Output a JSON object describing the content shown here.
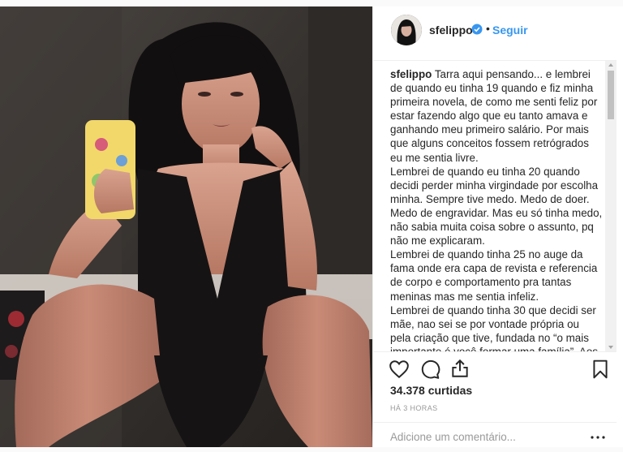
{
  "post": {
    "username": "sfelippo",
    "follow_label": "Seguir",
    "dot": "•",
    "caption_user": "sfelippo",
    "caption_text": " Tarra aqui pensando... e lembrei de quando eu tinha 19 quando e fiz minha primeira novela, de como me senti feliz por estar fazendo algo que eu tanto amava e ganhando meu primeiro salário. Por mais que alguns conceitos fossem retrógrados eu me sentia livre.\nLembrei de quando eu tinha 20 quando decidi perder minha virgindade por escolha minha. Sempre tive medo. Medo de doer. Medo de engravidar. Mas eu só tinha medo, não sabia muita coisa sobre o assunto, pq não me explicaram.\nLembrei de quando tinha 25 no auge da fama onde era capa de revista e referencia de corpo e comportamento pra tantas meninas mas me sentia infeliz.\nLembrei de quando tinha 30 que decidi ser mãe, nao sei se por vontade própria ou pela criação que tive, fundada no “o mais importante é você formar uma família”. Aos",
    "likes": "34.378 curtidas",
    "time": "HÁ 3 HORAS",
    "comment_placeholder": "Adicione um comentário...",
    "more_label": "•••"
  },
  "icons": {
    "like": "heart-icon",
    "comment": "comment-icon",
    "share": "share-icon",
    "save": "bookmark-icon",
    "verified": "verified-badge-icon",
    "more": "more-options-icon"
  },
  "colors": {
    "link": "#3897f0",
    "text": "#262626",
    "muted": "#999999",
    "border": "#efefef"
  }
}
